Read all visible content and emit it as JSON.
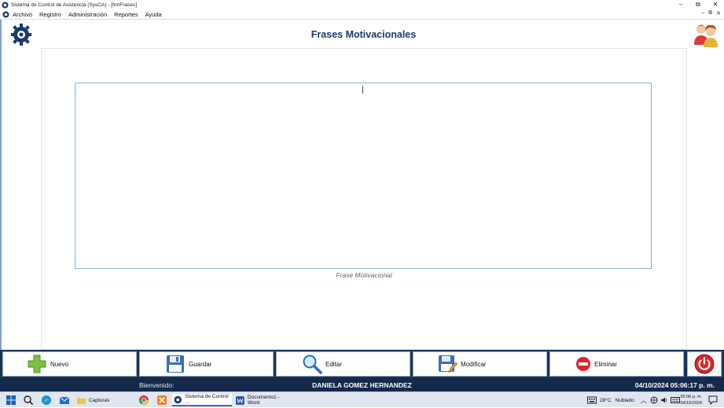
{
  "window": {
    "title": "Sistema de Control de Asistencia (SysCA) - [frmFrases]",
    "controls": [
      "–",
      "⧉",
      "✕"
    ]
  },
  "menu": {
    "items": [
      "Archivo",
      "Registro",
      "Administración",
      "Reportes",
      "Ayuda"
    ],
    "mdi_controls": [
      "–",
      "⧉",
      "✕"
    ]
  },
  "form": {
    "title": "Frases Motivacionales",
    "phrase_value": "",
    "phrase_label": "Frase Motivacional"
  },
  "toolbar": {
    "new_label": "Nuevo",
    "save_label": "Guardar",
    "edit_label": "Editar",
    "modify_label": "Modificar",
    "delete_label": "Eliminar"
  },
  "status": {
    "welcome": "Bienvenido:",
    "user": "DANIELA GOMEZ HERNANDEZ",
    "datetime": "04/10/2024 05:06:17 p. m."
  },
  "taskbar": {
    "apps": [
      {
        "label": "Capturas"
      },
      {
        "label": "Sistema de Control ..."
      },
      {
        "label": "Documento1 - Word"
      }
    ],
    "weather_temp": "28°C",
    "weather_text": "Nublado",
    "time": "05:06 p. m.",
    "date": "04/10/2024"
  },
  "colors": {
    "title": "#1a3a6e",
    "toolbar_bg": "#1c3356",
    "statusbar_bg": "#15294a",
    "textbox_border": "#7eb3de"
  },
  "icons": {
    "new": "plus-icon",
    "save": "floppy-disk-icon",
    "edit": "magnifier-icon",
    "modify": "floppy-edit-icon",
    "delete": "minus-circle-icon",
    "exit": "power-icon"
  }
}
